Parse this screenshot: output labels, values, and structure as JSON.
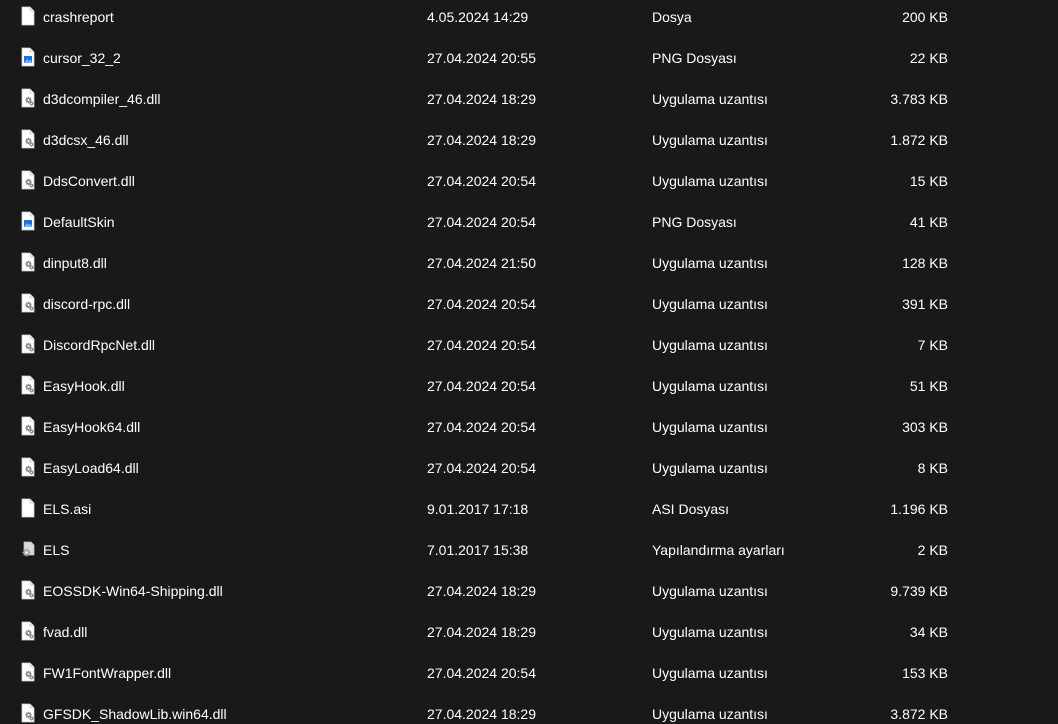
{
  "files": [
    {
      "name": "crashreport",
      "date": "4.05.2024 14:29",
      "type": "Dosya",
      "size": "200 KB",
      "icon": "blank-file-icon"
    },
    {
      "name": "cursor_32_2",
      "date": "27.04.2024 20:55",
      "type": "PNG Dosyası",
      "size": "22 KB",
      "icon": "image-file-icon"
    },
    {
      "name": "d3dcompiler_46.dll",
      "date": "27.04.2024 18:29",
      "type": "Uygulama uzantısı",
      "size": "3.783 KB",
      "icon": "dll-file-icon"
    },
    {
      "name": "d3dcsx_46.dll",
      "date": "27.04.2024 18:29",
      "type": "Uygulama uzantısı",
      "size": "1.872 KB",
      "icon": "dll-file-icon"
    },
    {
      "name": "DdsConvert.dll",
      "date": "27.04.2024 20:54",
      "type": "Uygulama uzantısı",
      "size": "15 KB",
      "icon": "dll-file-icon"
    },
    {
      "name": "DefaultSkin",
      "date": "27.04.2024 20:54",
      "type": "PNG Dosyası",
      "size": "41 KB",
      "icon": "image-file-icon"
    },
    {
      "name": "dinput8.dll",
      "date": "27.04.2024 21:50",
      "type": "Uygulama uzantısı",
      "size": "128 KB",
      "icon": "dll-file-icon"
    },
    {
      "name": "discord-rpc.dll",
      "date": "27.04.2024 20:54",
      "type": "Uygulama uzantısı",
      "size": "391 KB",
      "icon": "dll-file-icon"
    },
    {
      "name": "DiscordRpcNet.dll",
      "date": "27.04.2024 20:54",
      "type": "Uygulama uzantısı",
      "size": "7 KB",
      "icon": "dll-file-icon"
    },
    {
      "name": "EasyHook.dll",
      "date": "27.04.2024 20:54",
      "type": "Uygulama uzantısı",
      "size": "51 KB",
      "icon": "dll-file-icon"
    },
    {
      "name": "EasyHook64.dll",
      "date": "27.04.2024 20:54",
      "type": "Uygulama uzantısı",
      "size": "303 KB",
      "icon": "dll-file-icon"
    },
    {
      "name": "EasyLoad64.dll",
      "date": "27.04.2024 20:54",
      "type": "Uygulama uzantısı",
      "size": "8 KB",
      "icon": "dll-file-icon"
    },
    {
      "name": "ELS.asi",
      "date": "9.01.2017 17:18",
      "type": "ASI Dosyası",
      "size": "1.196 KB",
      "icon": "blank-file-icon"
    },
    {
      "name": "ELS",
      "date": "7.01.2017 15:38",
      "type": "Yapılandırma ayarları",
      "size": "2 KB",
      "icon": "config-file-icon"
    },
    {
      "name": "EOSSDK-Win64-Shipping.dll",
      "date": "27.04.2024 18:29",
      "type": "Uygulama uzantısı",
      "size": "9.739 KB",
      "icon": "dll-file-icon"
    },
    {
      "name": "fvad.dll",
      "date": "27.04.2024 18:29",
      "type": "Uygulama uzantısı",
      "size": "34 KB",
      "icon": "dll-file-icon"
    },
    {
      "name": "FW1FontWrapper.dll",
      "date": "27.04.2024 20:54",
      "type": "Uygulama uzantısı",
      "size": "153 KB",
      "icon": "dll-file-icon"
    },
    {
      "name": "GFSDK_ShadowLib.win64.dll",
      "date": "27.04.2024 18:29",
      "type": "Uygulama uzantısı",
      "size": "3.872 KB",
      "icon": "dll-file-icon"
    }
  ],
  "colors": {
    "background": "#191919",
    "text": "#ffffff",
    "file_page": "#ffffff",
    "image_accent": "#1e6fd9",
    "gear": "#8a8a8a"
  }
}
